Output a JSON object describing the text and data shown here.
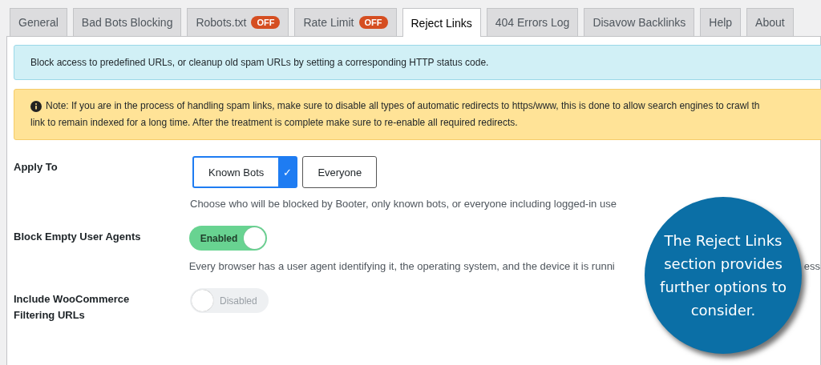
{
  "tabs": [
    {
      "label": "General",
      "selected": false
    },
    {
      "label": "Bad Bots Blocking",
      "selected": false
    },
    {
      "label": "Robots.txt",
      "badge": "OFF",
      "selected": false
    },
    {
      "label": "Rate Limit",
      "badge": "OFF",
      "selected": false
    },
    {
      "label": "Reject Links",
      "selected": true
    },
    {
      "label": "404 Errors Log",
      "selected": false
    },
    {
      "label": "Disavow Backlinks",
      "selected": false
    },
    {
      "label": "Help",
      "selected": false
    },
    {
      "label": "About",
      "selected": false
    }
  ],
  "info_notice": "Block access to predefined URLs, or cleanup old spam URLs by setting a corresponding HTTP status code.",
  "warning_notice": {
    "lines": [
      "Note: If you are in the process of handling spam links, make sure to disable all types of automatic redirects to https/www, this is done to allow search engines to crawl th",
      "link to remain indexed for a long time. After the treatment is complete make sure to re-enable all required redirects."
    ]
  },
  "settings": [
    {
      "kind": "choice",
      "label": "Apply To",
      "check_mark": "✓",
      "options": [
        {
          "label": "Known Bots",
          "selected": true
        },
        {
          "label": "Everyone",
          "selected": false
        }
      ],
      "description": "Choose who will be blocked by Booter, only known bots, or everyone including logged-in use"
    },
    {
      "kind": "switch",
      "label": "Block Empty User Agents",
      "on": true,
      "state_label": "Enabled",
      "description": "Every browser has a user agent identifying it, the operating system, and the device it is runni",
      "description_tail": "ess"
    },
    {
      "kind": "switch",
      "label": "Include WooCommerce Filtering URLs",
      "on": false,
      "state_label": "Disabled"
    }
  ],
  "callout": "The Reject Links section provides further options to consider."
}
